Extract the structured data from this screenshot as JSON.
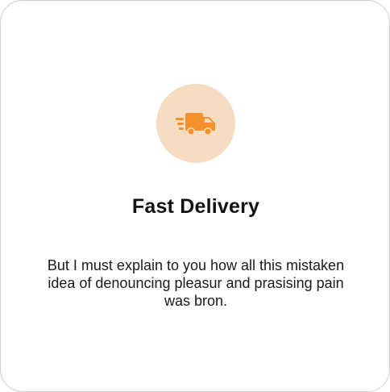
{
  "feature_card": {
    "icon": "delivery-truck-icon",
    "title": "Fast Delivery",
    "description": "But I must explain to you how all this mistaken idea of denouncing pleasur and prasising pain was bron."
  },
  "colors": {
    "accent": "#f5912d",
    "icon_background": "#f6dcc0",
    "border": "#cfcfcf",
    "text": "#111111"
  }
}
